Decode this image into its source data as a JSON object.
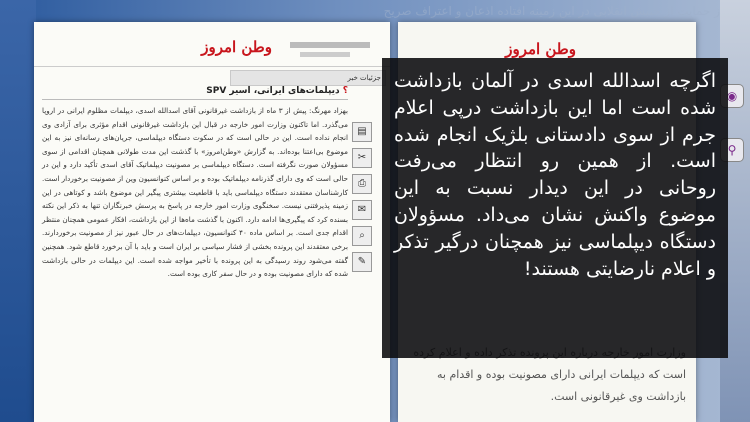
{
  "background": {
    "faded_text": "ز حمایت از جنبش انقلابی در این زمینه افتاده اذعان و اعتراف صریح"
  },
  "left_page": {
    "logo": "وطن امروز",
    "news_tab": "جزئیات خبر",
    "article_title_prefix": "؟",
    "article_title": "دیپلمات‌های ایرانی، اسیر SPV",
    "article_body": "بهزاد مهرنگ: پیش از ۳ ماه از بازداشت غیرقانونی آقای اسدالله اسدی، دیپلمات مظلوم ایرانی در اروپا می‌گذرد. اما تاکنون وزارت امور خارجه در قبال این بازداشت غیرقانونی اقدام مؤثری برای آزادی وی انجام نداده است. این در حالی است که در سکوت دستگاه دیپلماسی، جریان‌های رسانه‌ای نیز به این موضوع بی‌اعتنا بوده‌اند. به گزارش «وطن‌امروز» با گذشت این مدت طولانی همچنان اقدامی از سوی مسؤولان صورت نگرفته است. دستگاه دیپلماسی بر مصونیت دیپلماتیک آقای اسدی تأکید دارد و این در حالی است که وی دارای گذرنامه دیپلماتیک بوده و بر اساس کنوانسیون وین از مصونیت برخوردار است. کارشناسان معتقدند دستگاه دیپلماسی باید با قاطعیت بیشتری پیگیر این موضوع باشد و کوتاهی در این زمینه پذیرفتنی نیست. سخنگوی وزارت امور خارجه در پاسخ به پرسش خبرنگاران تنها به ذکر این نکته بسنده کرد که پیگیری‌ها ادامه دارد. اکنون با گذشت ماه‌ها از این بازداشت، افکار عمومی همچنان منتظر اقدام جدی است. بر اساس ماده ۴۰ کنوانسیون، دیپلمات‌های در حال عبور نیز از مصونیت برخوردارند. برخی معتقدند این پرونده بخشی از فشار سیاسی بر ایران است و باید با آن برخورد قاطع شود. همچنین گفته می‌شود روند رسیدگی به این پرونده با تأخیر مواجه شده است. این دیپلمات در حالی بازداشت شده که دارای مصونیت بوده و در حال سفر کاری بوده است."
  },
  "right_page": {
    "logo": "وطن امروز",
    "bottom_text": "وزارت امور خارجه درباره این پرونده تذکر داده و اعلام کرده است که دیپلمات ایرانی دارای مصونیت بوده و اقدام به بازداشت وی غیرقانونی است."
  },
  "overlay": {
    "text": "اگرچه اسدالله اسدی در آلمان بازداشت شده است اما این بازداشت درپی اعلام جرم از سوی دادستانی بلژیک انجام شده است. از همین رو انتظار می‌رفت روحانی در این دیدار نسبت به این موضوع واکنش نشان می‌داد. مسؤولان دستگاه دیپلماسی نیز همچنان درگیر تذکر و اعلام نارضایتی هستند!"
  },
  "colors": {
    "logo_red": "#c8161d",
    "overlay_bg": "#0a0a0c",
    "background_blue": "#2b5a9e"
  },
  "icons": [
    "pdf-icon",
    "cut-icon",
    "print-icon",
    "email-icon",
    "zoom-icon",
    "note-icon"
  ]
}
